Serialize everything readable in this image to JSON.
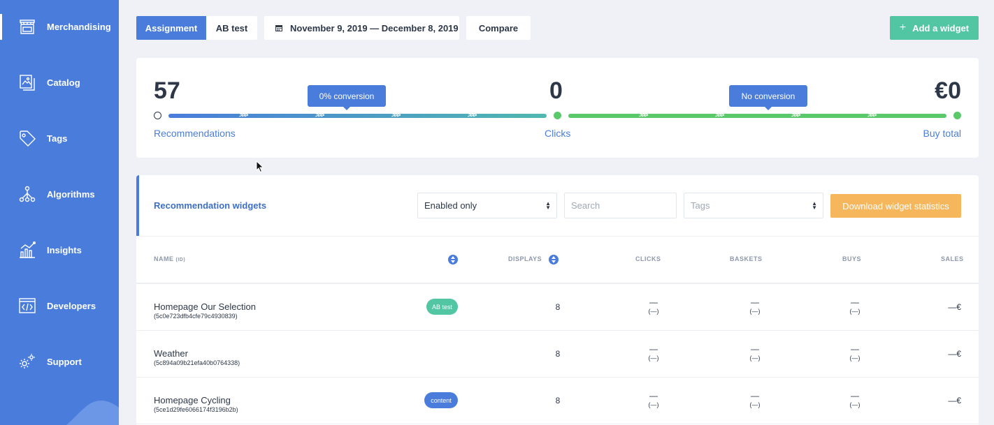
{
  "sidebar": {
    "items": [
      {
        "label": "Merchandising",
        "icon": "store-icon",
        "active": true
      },
      {
        "label": "Catalog",
        "icon": "catalog-icon"
      },
      {
        "label": "Tags",
        "icon": "tag-icon"
      },
      {
        "label": "Algorithms",
        "icon": "algorithm-icon"
      },
      {
        "label": "Insights",
        "icon": "chart-icon"
      },
      {
        "label": "Developers",
        "icon": "code-icon"
      },
      {
        "label": "Support",
        "icon": "gear-icon"
      }
    ]
  },
  "toolbar": {
    "assignment_label": "Assignment",
    "abtest_label": "AB test",
    "date_range": "November 9, 2019 — December 8, 2019",
    "compare_label": "Compare",
    "add_widget_label": "Add a widget"
  },
  "funnel": {
    "recommendations_value": "57",
    "recommendations_label": "Recommendations",
    "clicks_value": "0",
    "clicks_label": "Clicks",
    "buy_value": "€0",
    "buy_label": "Buy total",
    "conversion1": "0% conversion",
    "conversion2": "No conversion"
  },
  "widgets": {
    "title": "Recommendation widgets",
    "filter_value": "Enabled only",
    "search_placeholder": "Search",
    "tags_placeholder": "Tags",
    "download_label": "Download widget statistics",
    "columns": {
      "name": "NAME",
      "name_sub": "(ID)",
      "displays": "DISPLAYS",
      "clicks": "CLICKS",
      "baskets": "BASKETS",
      "buys": "BUYS",
      "sales": "SALES"
    },
    "rows": [
      {
        "name": "Homepage Our Selection",
        "id": "(5c0e723dfb4cfe79c4930839)",
        "badge": "AB test",
        "displays": "8",
        "clicks": "—",
        "clicks_sub": "(—)",
        "baskets": "—",
        "baskets_sub": "(—)",
        "buys": "—",
        "buys_sub": "(—)",
        "sales": "—€"
      },
      {
        "name": "Weather",
        "id": "(5c894a09b21efa40b0764338)",
        "badge": "",
        "displays": "8",
        "clicks": "—",
        "clicks_sub": "(—)",
        "baskets": "—",
        "baskets_sub": "(—)",
        "buys": "—",
        "buys_sub": "(—)",
        "sales": "—€"
      },
      {
        "name": "Homepage Cycling",
        "id": "(5ce1d29fe6066174f3196b2b)",
        "badge": "content",
        "displays": "8",
        "clicks": "—",
        "clicks_sub": "(—)",
        "baskets": "—",
        "baskets_sub": "(—)",
        "buys": "—",
        "buys_sub": "(—)",
        "sales": "—€"
      }
    ]
  },
  "colors": {
    "primary": "#4a7ddb",
    "success": "#52c5a2",
    "warning": "#f5b65c",
    "progress_green": "#5ac96a"
  }
}
